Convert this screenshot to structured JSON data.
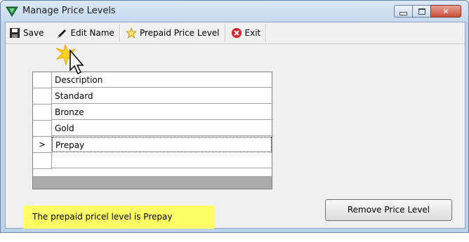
{
  "window": {
    "title": "Manage Price Levels",
    "controls": {
      "minimize": "minimize",
      "maximize": "maximize",
      "close": "close"
    }
  },
  "toolbar": {
    "save_label": "Save",
    "edit_name_label": "Edit Name",
    "prepaid_label": "Prepaid Price Level",
    "exit_label": "Exit"
  },
  "grid": {
    "rows": [
      {
        "indicator": "",
        "description": "Description"
      },
      {
        "indicator": "",
        "description": "Standard"
      },
      {
        "indicator": "",
        "description": "Bronze"
      },
      {
        "indicator": "",
        "description": "Gold"
      },
      {
        "indicator": ">",
        "description": "Prepay"
      },
      {
        "indicator": "",
        "description": ""
      }
    ]
  },
  "status_text": "The prepaid pricel level is Prepay",
  "remove_button_label": "Remove Price Level",
  "icons": {
    "app": "app-triangle-icon",
    "save": "floppy-disk-icon",
    "edit": "pencil-icon",
    "prepaid": "star-icon",
    "exit": "red-x-icon",
    "cursor": "mouse-pointer-icon"
  },
  "colors": {
    "titlebar": "#c6d9ee",
    "highlight": "#ffff66",
    "close_button": "#c6503a"
  }
}
